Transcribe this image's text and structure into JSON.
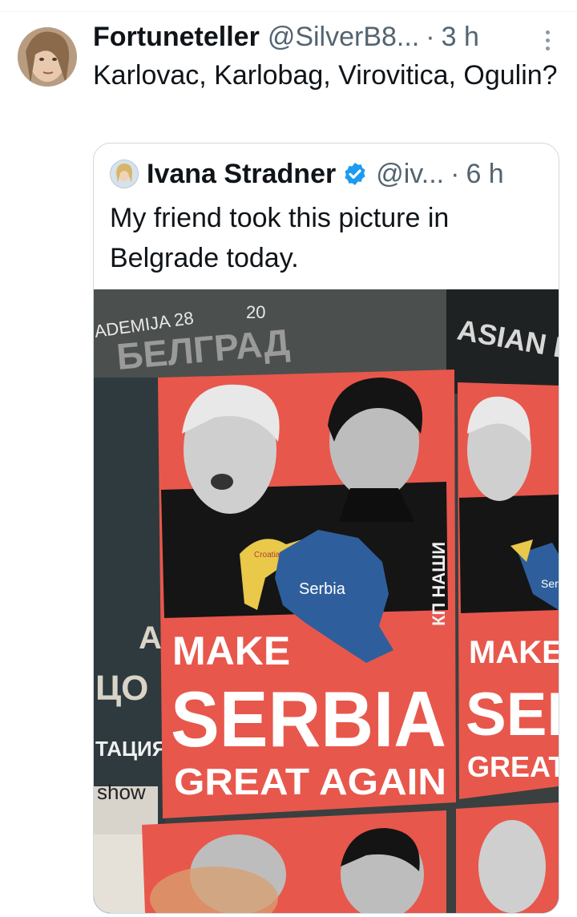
{
  "tweet": {
    "author_name": "Fortuneteller",
    "author_handle": "@SilverB8...",
    "separator": "·",
    "time": "3 h",
    "text": "Karlovac, Karlobag, Virovitica, Ogulin?",
    "icons": {
      "more": "more-vertical-icon",
      "avatar": "avatar"
    }
  },
  "quoted_tweet": {
    "author_name": "Ivana Stradner",
    "author_handle": "@iv...",
    "separator": "·",
    "time": "6 h",
    "verified": true,
    "verified_color": "#1d9bf0",
    "text": "My friend took this picture in Belgrade today.",
    "photo": {
      "wall_text_1": "ADEMIJA 28",
      "wall_text_2": "20",
      "wall_text_3": "БЕЛГРАД",
      "wall_text_4": "ASIAN DU",
      "wall_text_5": "ЦО",
      "wall_text_6": "ТАЦИЯ",
      "wall_text_7": "show",
      "wall_text_8": "A",
      "map_label_croatia": "Croatia",
      "map_label_serbia": "Serbia",
      "map_label_serbia_cut": "Serbi",
      "side_text": "КП НАШИ",
      "poster_line1": "MAKE",
      "poster_line2": "SERBIA",
      "poster_line3": "GREAT AGAIN",
      "poster2_line2": "SER",
      "poster2_line3": "GREAT A",
      "poster_color": "#e8574c",
      "map_color": "#2e5f9c",
      "croatia_color": "#e9c84a"
    }
  }
}
